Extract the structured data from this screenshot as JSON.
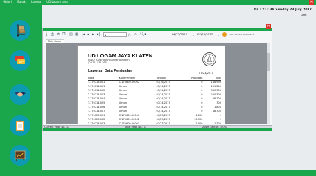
{
  "app": {
    "menu": [
      "Histori",
      "Barak",
      "Lapora",
      "UD Logam Jaya"
    ],
    "clock": "03 : 21 : 38  Sunday 23 July 2017",
    "user": "user"
  },
  "sidebar": {
    "icons": [
      "hand-truck-icon",
      "chat-icon",
      "handshake-icon",
      "clipboard-icon",
      "chart-icon"
    ]
  },
  "viewer": {
    "toolbar": {
      "page_input": "1",
      "page_of": "/1",
      "date_from": "06/22/2017",
      "date_to": "07/23/2017",
      "sap_label": "SAP CRYSTAL REPORTS®"
    },
    "tab_label": "Main Report",
    "status": {
      "current_page": "Current Page No.: 1",
      "total_page": "Total Page No.: 1",
      "zoom": "Zoom Factor: 100%"
    }
  },
  "report": {
    "company": "UD LOGAM JAYA KLATEN",
    "address": [
      "Pusur Karangjo Polanharjo Klaten",
      "(0272) 551365"
    ],
    "title": "Laporan Data Penjualan",
    "print_date": "07/23/2017",
    "columns": [
      "Nota",
      "Kode Pembeli",
      "Tanggal",
      "Potongan",
      "Total"
    ],
    "rows": [
      [
        "T-170716-001",
        "C-170609-00002",
        "07/16/2017",
        "0",
        "148.993"
      ],
      [
        "T-170714-001",
        "Umum",
        "07/14/2017",
        "0",
        "261.200"
      ],
      [
        "T-170714-002",
        "Umum",
        "07/14/2017",
        "0",
        "380.300"
      ],
      [
        "T-170714-003",
        "Umum",
        "07/14/2017",
        "0",
        "200.300"
      ],
      [
        "T-170714-004",
        "Umum",
        "07/14/2017",
        "0",
        "38.300"
      ],
      [
        "T-170714-005",
        "Umum",
        "07/14/2017",
        "0",
        "300"
      ],
      [
        "T-170714-006",
        "Umum",
        "07/14/2017",
        "0",
        "1.800"
      ],
      [
        "T-170714-007",
        "Umum",
        "07/14/2017",
        "0",
        "48.300"
      ],
      [
        "T-170723-001",
        "C-170609-00001",
        "07/23/2017",
        "1.000",
        "1"
      ],
      [
        "T-170723-002",
        "C-170609-00002",
        "07/23/2017",
        "18.300",
        "2"
      ],
      [
        "T-170723-003",
        "C-170609-00001",
        "07/23/2017",
        "1.000",
        "1.700"
      ]
    ]
  }
}
